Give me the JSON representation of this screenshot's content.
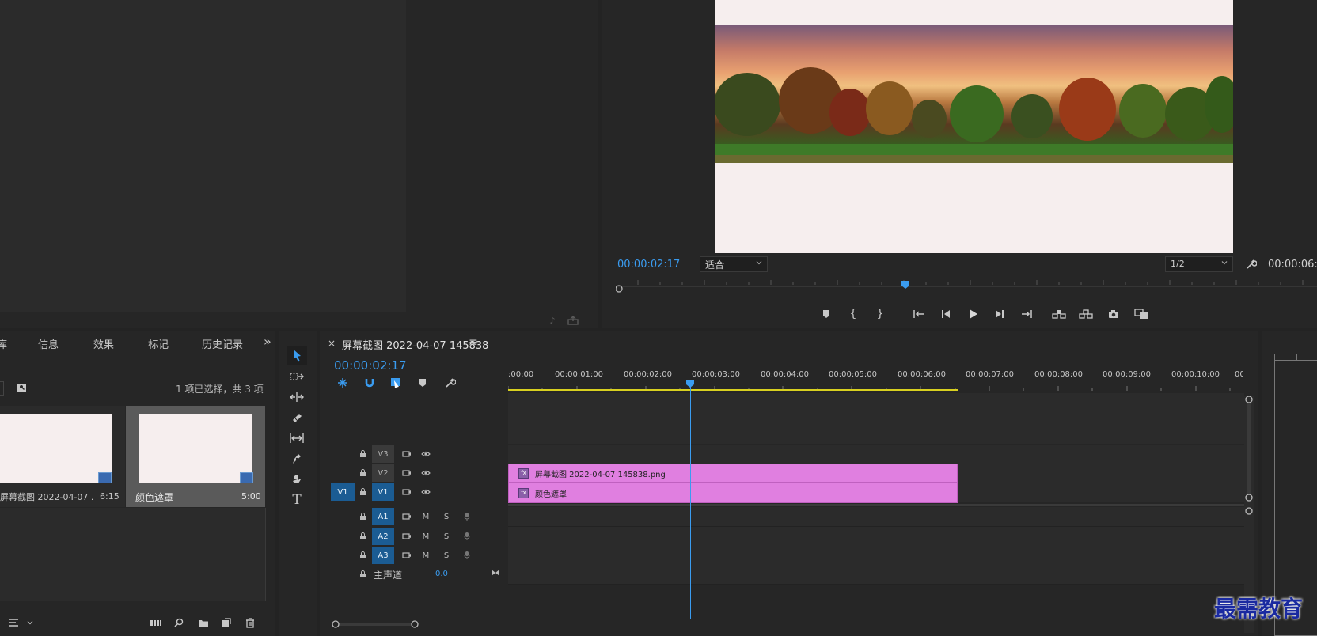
{
  "program_monitor": {
    "timecode": "00:00:02:17",
    "fit_select": "适合",
    "resolution_select": "1/2",
    "duration_timecode": "00:00:06:"
  },
  "project_panel": {
    "tabs": [
      "库",
      "信息",
      "效果",
      "标记",
      "历史记录"
    ],
    "more_label": "»",
    "selection_status": "1 项已选择，共 3 项",
    "items": [
      {
        "name": "屏幕截图 2022-04-07 ...",
        "duration": "6:15"
      },
      {
        "name": "颜色遮罩",
        "duration": "5:00"
      }
    ]
  },
  "timeline": {
    "close_label": "×",
    "sequence_name": "屏幕截图 2022-04-07 145838",
    "menu_label": "≡",
    "timecode": "00:00:02:17",
    "ruler_labels": [
      ":00:00",
      "00:00:01:00",
      "00:00:02:00",
      "00:00:03:00",
      "00:00:04:00",
      "00:00:05:00",
      "00:00:06:00",
      "00:00:07:00",
      "00:00:08:00",
      "00:00:09:00",
      "00:00:10:00",
      "00:0"
    ],
    "tracks": {
      "v3": "V3",
      "v2": "V2",
      "v1": "V1",
      "v1_source": "V1",
      "a1": "A1",
      "a2": "A2",
      "a3": "A3",
      "mute": "M",
      "solo": "S",
      "master_label": "主声道",
      "master_value": "0.0"
    },
    "clips": {
      "v2_clip": "屏幕截图 2022-04-07  145838.png",
      "v1_clip": "颜色遮罩",
      "fx_badge": "fx"
    }
  },
  "tools": {
    "type_tool_label": "T"
  },
  "watermark": "最需教育",
  "colors": {
    "accent_blue": "#3a9cf0",
    "clip_pink": "#e07fe0",
    "work_area_yellow": "#d8d020",
    "track_blue": "#1b5c93"
  }
}
